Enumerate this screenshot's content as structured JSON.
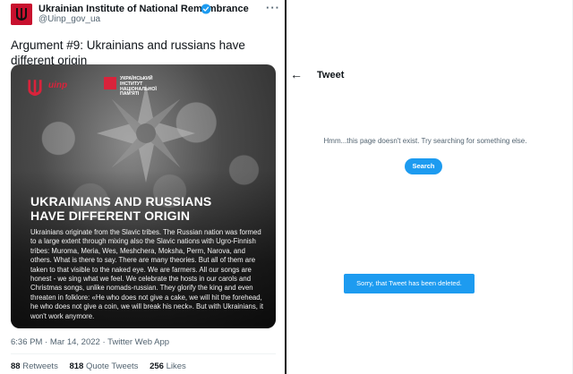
{
  "tweet": {
    "author_name": "Ukrainian Institute of National Remembrance",
    "handle": "@Uinp_gov_ua",
    "more_label": "···",
    "text": "Argument #9: Ukrainians and russians have different origin",
    "image": {
      "logo_text": "uinp",
      "institute_text": "УКРАЇНСЬКИЙ ІНСТИТУТ НАЦІОНАЛЬНОЇ ПАМ'ЯТІ",
      "headline": "UKRAINIANS AND RUSSIANS HAVE DIFFERENT ORIGIN",
      "body": "Ukrainians originate from the Slavic tribes. The Russian nation was formed to a large extent through mixing also the Slavic nations with Ugro-Finnish tribes: Muroma, Meria, Wes, Meshchera, Moksha, Perm, Narova, and others. What is there to say. There are many theories. But all of them are taken to that visible to the naked eye. We are farmers. All our songs are honest - we sing what we feel. We celebrate the hosts in our carols and Christmas songs, unlike nomads-russian. They glorify the king and even threaten in folklore: «He who does not give a cake, we will hit the forehead, he who does not give a coin, we will break his neck». But with Ukrainians, it won't work anymore."
    },
    "meta": "6:36 PM · Mar 14, 2022 · Twitter Web App",
    "stats": {
      "retweets_count": "88",
      "retweets_label": "Retweets",
      "quotes_count": "818",
      "quotes_label": "Quote Tweets",
      "likes_count": "256",
      "likes_label": "Likes"
    }
  },
  "right_panel": {
    "title": "Tweet",
    "back_icon": "←",
    "message": "Hmm...this page doesn't exist. Try searching for something else.",
    "search_button": "Search",
    "toast": "Sorry, that Tweet has been deleted."
  },
  "colors": {
    "accent": "#1d9bf0",
    "brand_red": "#c8102e",
    "secondary_text": "#536471"
  }
}
